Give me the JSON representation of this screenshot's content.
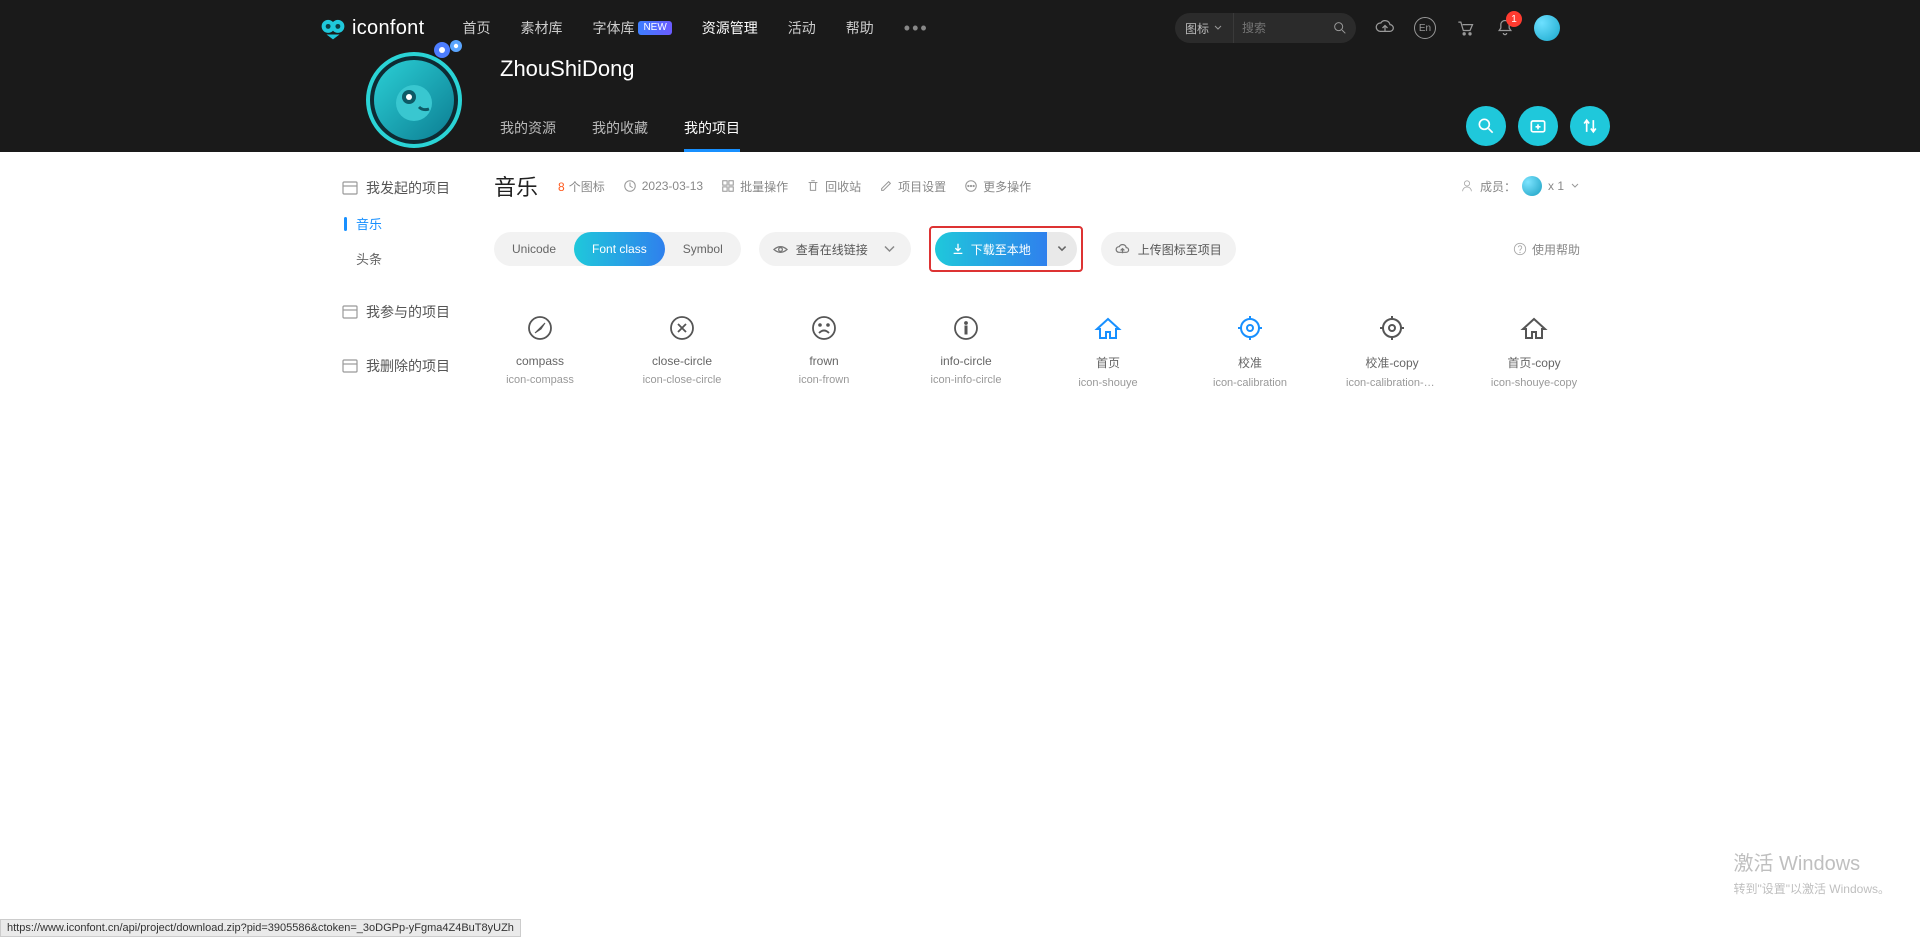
{
  "brand": {
    "name": "iconfont"
  },
  "nav": {
    "items": [
      {
        "label": "首页"
      },
      {
        "label": "素材库"
      },
      {
        "label": "字体库",
        "badge": "NEW"
      },
      {
        "label": "资源管理",
        "active": true
      },
      {
        "label": "活动"
      },
      {
        "label": "帮助"
      }
    ]
  },
  "search": {
    "type": "图标",
    "placeholder": "搜索"
  },
  "notif_count": "1",
  "lang": "En",
  "profile": {
    "username": "ZhouShiDong",
    "tabs": [
      {
        "label": "我的资源"
      },
      {
        "label": "我的收藏"
      },
      {
        "label": "我的项目",
        "active": true
      }
    ]
  },
  "sidebar": {
    "group_started": "我发起的项目",
    "group_joined": "我参与的项目",
    "group_deleted": "我删除的项目",
    "projects": [
      {
        "label": "音乐",
        "active": true
      },
      {
        "label": "头条"
      }
    ]
  },
  "project": {
    "title": "音乐",
    "count": "8",
    "count_label": "个图标",
    "date": "2023-03-13",
    "batch": "批量操作",
    "recycle": "回收站",
    "settings": "项目设置",
    "more": "更多操作",
    "members_label": "成员：",
    "members_count": "x 1"
  },
  "toolbar": {
    "segs": [
      {
        "label": "Unicode"
      },
      {
        "label": "Font class",
        "active": true
      },
      {
        "label": "Symbol"
      }
    ],
    "view_online": "查看在线链接",
    "download": "下载至本地",
    "upload": "上传图标至项目",
    "help": "使用帮助"
  },
  "icons": [
    {
      "label": "compass",
      "code": "icon-compass",
      "glyph": "compass"
    },
    {
      "label": "close-circle",
      "code": "icon-close-circle",
      "glyph": "close-circle"
    },
    {
      "label": "frown",
      "code": "icon-frown",
      "glyph": "frown"
    },
    {
      "label": "info-circle",
      "code": "icon-info-circle",
      "glyph": "info-circle"
    },
    {
      "label": "首页",
      "code": "icon-shouye",
      "glyph": "home",
      "color": "#1890ff"
    },
    {
      "label": "校准",
      "code": "icon-calibration",
      "glyph": "target",
      "color": "#1890ff"
    },
    {
      "label": "校准-copy",
      "code": "icon-calibration-c...",
      "glyph": "target"
    },
    {
      "label": "首页-copy",
      "code": "icon-shouye-copy",
      "glyph": "home"
    }
  ],
  "watermark": {
    "title": "激活 Windows",
    "sub": "转到\"设置\"以激活 Windows。"
  },
  "status_url": "https://www.iconfont.cn/api/project/download.zip?pid=3905586&ctoken=_3oDGPp-yFgma4Z4BuT8yUZh"
}
